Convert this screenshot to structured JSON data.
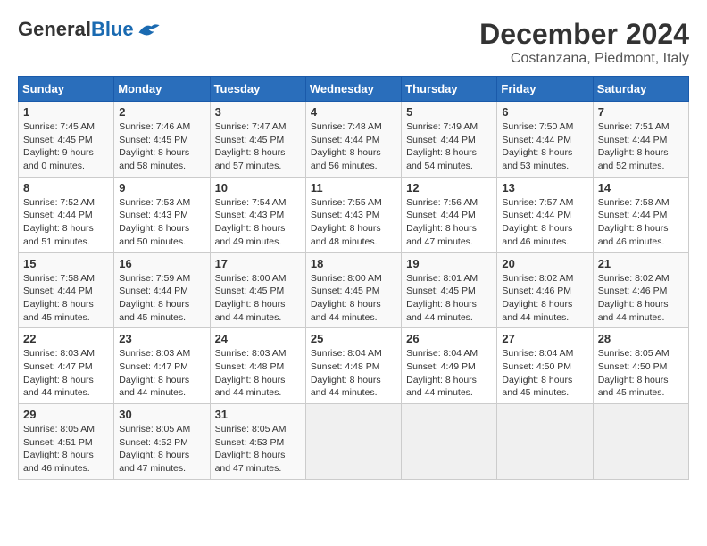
{
  "header": {
    "logo": {
      "general": "General",
      "blue": "Blue"
    },
    "title": "December 2024",
    "subtitle": "Costanzana, Piedmont, Italy"
  },
  "calendar": {
    "days_of_week": [
      "Sunday",
      "Monday",
      "Tuesday",
      "Wednesday",
      "Thursday",
      "Friday",
      "Saturday"
    ],
    "weeks": [
      [
        null,
        null,
        null,
        null,
        null,
        null,
        null
      ]
    ],
    "cells": [
      {
        "day": 1,
        "col": 0,
        "sunrise": "7:45 AM",
        "sunset": "4:45 PM",
        "daylight": "9 hours and 0 minutes."
      },
      {
        "day": 2,
        "col": 1,
        "sunrise": "7:46 AM",
        "sunset": "4:45 PM",
        "daylight": "8 hours and 58 minutes."
      },
      {
        "day": 3,
        "col": 2,
        "sunrise": "7:47 AM",
        "sunset": "4:45 PM",
        "daylight": "8 hours and 57 minutes."
      },
      {
        "day": 4,
        "col": 3,
        "sunrise": "7:48 AM",
        "sunset": "4:44 PM",
        "daylight": "8 hours and 56 minutes."
      },
      {
        "day": 5,
        "col": 4,
        "sunrise": "7:49 AM",
        "sunset": "4:44 PM",
        "daylight": "8 hours and 54 minutes."
      },
      {
        "day": 6,
        "col": 5,
        "sunrise": "7:50 AM",
        "sunset": "4:44 PM",
        "daylight": "8 hours and 53 minutes."
      },
      {
        "day": 7,
        "col": 6,
        "sunrise": "7:51 AM",
        "sunset": "4:44 PM",
        "daylight": "8 hours and 52 minutes."
      },
      {
        "day": 8,
        "col": 0,
        "sunrise": "7:52 AM",
        "sunset": "4:44 PM",
        "daylight": "8 hours and 51 minutes."
      },
      {
        "day": 9,
        "col": 1,
        "sunrise": "7:53 AM",
        "sunset": "4:43 PM",
        "daylight": "8 hours and 50 minutes."
      },
      {
        "day": 10,
        "col": 2,
        "sunrise": "7:54 AM",
        "sunset": "4:43 PM",
        "daylight": "8 hours and 49 minutes."
      },
      {
        "day": 11,
        "col": 3,
        "sunrise": "7:55 AM",
        "sunset": "4:43 PM",
        "daylight": "8 hours and 48 minutes."
      },
      {
        "day": 12,
        "col": 4,
        "sunrise": "7:56 AM",
        "sunset": "4:44 PM",
        "daylight": "8 hours and 47 minutes."
      },
      {
        "day": 13,
        "col": 5,
        "sunrise": "7:57 AM",
        "sunset": "4:44 PM",
        "daylight": "8 hours and 46 minutes."
      },
      {
        "day": 14,
        "col": 6,
        "sunrise": "7:58 AM",
        "sunset": "4:44 PM",
        "daylight": "8 hours and 46 minutes."
      },
      {
        "day": 15,
        "col": 0,
        "sunrise": "7:58 AM",
        "sunset": "4:44 PM",
        "daylight": "8 hours and 45 minutes."
      },
      {
        "day": 16,
        "col": 1,
        "sunrise": "7:59 AM",
        "sunset": "4:44 PM",
        "daylight": "8 hours and 45 minutes."
      },
      {
        "day": 17,
        "col": 2,
        "sunrise": "8:00 AM",
        "sunset": "4:45 PM",
        "daylight": "8 hours and 44 minutes."
      },
      {
        "day": 18,
        "col": 3,
        "sunrise": "8:00 AM",
        "sunset": "4:45 PM",
        "daylight": "8 hours and 44 minutes."
      },
      {
        "day": 19,
        "col": 4,
        "sunrise": "8:01 AM",
        "sunset": "4:45 PM",
        "daylight": "8 hours and 44 minutes."
      },
      {
        "day": 20,
        "col": 5,
        "sunrise": "8:02 AM",
        "sunset": "4:46 PM",
        "daylight": "8 hours and 44 minutes."
      },
      {
        "day": 21,
        "col": 6,
        "sunrise": "8:02 AM",
        "sunset": "4:46 PM",
        "daylight": "8 hours and 44 minutes."
      },
      {
        "day": 22,
        "col": 0,
        "sunrise": "8:03 AM",
        "sunset": "4:47 PM",
        "daylight": "8 hours and 44 minutes."
      },
      {
        "day": 23,
        "col": 1,
        "sunrise": "8:03 AM",
        "sunset": "4:47 PM",
        "daylight": "8 hours and 44 minutes."
      },
      {
        "day": 24,
        "col": 2,
        "sunrise": "8:03 AM",
        "sunset": "4:48 PM",
        "daylight": "8 hours and 44 minutes."
      },
      {
        "day": 25,
        "col": 3,
        "sunrise": "8:04 AM",
        "sunset": "4:48 PM",
        "daylight": "8 hours and 44 minutes."
      },
      {
        "day": 26,
        "col": 4,
        "sunrise": "8:04 AM",
        "sunset": "4:49 PM",
        "daylight": "8 hours and 44 minutes."
      },
      {
        "day": 27,
        "col": 5,
        "sunrise": "8:04 AM",
        "sunset": "4:50 PM",
        "daylight": "8 hours and 45 minutes."
      },
      {
        "day": 28,
        "col": 6,
        "sunrise": "8:05 AM",
        "sunset": "4:50 PM",
        "daylight": "8 hours and 45 minutes."
      },
      {
        "day": 29,
        "col": 0,
        "sunrise": "8:05 AM",
        "sunset": "4:51 PM",
        "daylight": "8 hours and 46 minutes."
      },
      {
        "day": 30,
        "col": 1,
        "sunrise": "8:05 AM",
        "sunset": "4:52 PM",
        "daylight": "8 hours and 47 minutes."
      },
      {
        "day": 31,
        "col": 2,
        "sunrise": "8:05 AM",
        "sunset": "4:53 PM",
        "daylight": "8 hours and 47 minutes."
      }
    ],
    "labels": {
      "sunrise": "Sunrise:",
      "sunset": "Sunset:",
      "daylight": "Daylight:"
    }
  }
}
